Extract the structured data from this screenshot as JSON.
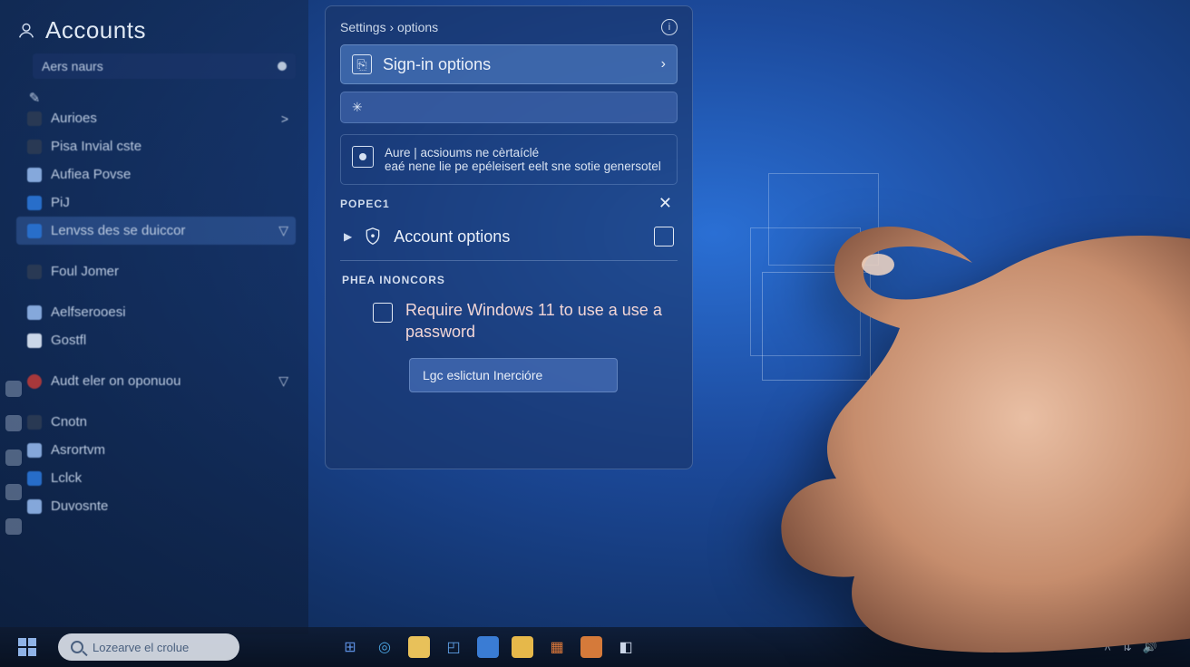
{
  "sidebar": {
    "title": "Accounts",
    "user_line": "Aers naurs",
    "items": [
      {
        "label": "",
        "icon": "pen"
      },
      {
        "label": "Aurioes",
        "icon": "sq-dark",
        "chev": ">"
      },
      {
        "label": "Pisa Invial cste",
        "icon": "sq-dark"
      },
      {
        "label": "Aufiea Povse",
        "icon": "sq-light"
      },
      {
        "label": "PiJ",
        "icon": "sq-blue"
      },
      {
        "label": "Lenvss des se duiccor",
        "icon": "sq-blue",
        "chev": "▽",
        "active": true
      },
      {
        "label": "Foul Jomer",
        "icon": "sq-dark"
      },
      {
        "label": "Aelfserooesi",
        "icon": "sq-light"
      },
      {
        "label": "Gostfl",
        "icon": "sq-white"
      },
      {
        "label": "Audt eler on oponuou",
        "icon": "sq-red",
        "chev": "▽"
      },
      {
        "label": "Cnotn",
        "icon": "sq-dark"
      },
      {
        "label": "Asrortvm",
        "icon": "sq-light"
      },
      {
        "label": "Lclck",
        "icon": "sq-blue"
      },
      {
        "label": "Duvosnte",
        "icon": "sq-light"
      }
    ]
  },
  "panel": {
    "breadcrumb": "Settings › options",
    "signin_label": "Sign-in options",
    "note_line1": "Aure | acsioums ne cèrtaíclé",
    "note_line2": "eaé nene lie pe epéleisert eelt sne sotie genersotel",
    "section1": "POPEC1",
    "account_options": "Account options",
    "section2": "PHEA INONCORS",
    "require_text": "Require Windows 11 to use a use a password",
    "footer_label": "Lgc eslictun Inercióre"
  },
  "taskbar": {
    "search_placeholder": "Lozearve el crolue",
    "clock": "",
    "date": ""
  }
}
